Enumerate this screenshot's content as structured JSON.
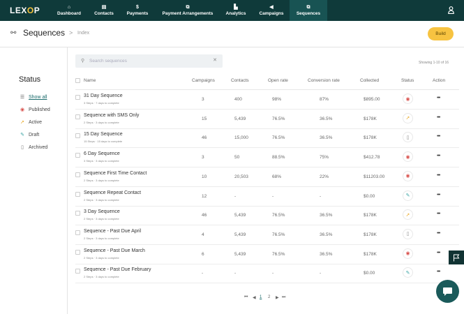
{
  "nav": {
    "logo": "LEXOP",
    "items": [
      {
        "icon": "⌂",
        "label": "Dashboard"
      },
      {
        "icon": "▤",
        "label": "Contacts"
      },
      {
        "icon": "$",
        "label": "Payments"
      },
      {
        "icon": "⧉",
        "label": "Payment Arrangements"
      },
      {
        "icon": "▙",
        "label": "Analytics"
      },
      {
        "icon": "◀",
        "label": "Campaigns"
      },
      {
        "icon": "⧉",
        "label": "Sequences"
      }
    ],
    "active": "Sequences"
  },
  "header": {
    "title": "Sequences",
    "separator": ">",
    "breadcrumb": "Index",
    "build_label": "Build"
  },
  "sidebar": {
    "title": "Status",
    "items": [
      {
        "label": "Show all",
        "icon": "list-icon"
      },
      {
        "label": "Published",
        "icon": "eye-icon"
      },
      {
        "label": "Active",
        "icon": "rocket-icon"
      },
      {
        "label": "Draft",
        "icon": "edit-icon"
      },
      {
        "label": "Archived",
        "icon": "archive-icon"
      }
    ]
  },
  "search": {
    "placeholder": "Search sequences",
    "value": ""
  },
  "showing": "Showing 1-10 of 16",
  "table": {
    "columns": [
      "Name",
      "Campaigns",
      "Contacts",
      "Open rate",
      "Conversion rate",
      "Collected",
      "Status",
      "Action"
    ],
    "rows": [
      {
        "name": "31 Day Sequence",
        "sub": "3 Steps  ·  7 days to complete",
        "campaigns": "3",
        "contacts": "400",
        "open": "98%",
        "conv": "87%",
        "collected": "$895.00",
        "status": "published"
      },
      {
        "name": "Sequence with SMS Only",
        "sub": "2 Steps  ·  3 days to complete",
        "campaigns": "15",
        "contacts": "5,439",
        "open": "76.5%",
        "conv": "36.5%",
        "collected": "$178K",
        "status": "active"
      },
      {
        "name": "15 Day Sequence",
        "sub": "15 Steps  ·  15 days to complete",
        "campaigns": "46",
        "contacts": "15,000",
        "open": "76.5%",
        "conv": "36.5%",
        "collected": "$178K",
        "status": "archived"
      },
      {
        "name": "6 Day Sequence",
        "sub": "3 Steps  ·  3 days to complete",
        "campaigns": "3",
        "contacts": "50",
        "open": "88.5%",
        "conv": "75%",
        "collected": "$412.78",
        "status": "published"
      },
      {
        "name": "Sequence First Time Contact",
        "sub": "2 Steps  ·  3 days to complete",
        "campaigns": "10",
        "contacts": "20,503",
        "open": "68%",
        "conv": "22%",
        "collected": "$11203.00",
        "status": "published"
      },
      {
        "name": "Sequence Repeat Contact",
        "sub": "2 Steps  ·  3 days to complete",
        "campaigns": "12",
        "contacts": "-",
        "open": "-",
        "conv": "-",
        "collected": "$0.00",
        "status": "draft"
      },
      {
        "name": "3 Day Sequence",
        "sub": "2 Steps  ·  3 days to complete",
        "campaigns": "46",
        "contacts": "5,439",
        "open": "76.5%",
        "conv": "36.5%",
        "collected": "$178K",
        "status": "active"
      },
      {
        "name": "Sequence - Past Due April",
        "sub": "2 Steps  ·  3 days to complete",
        "campaigns": "4",
        "contacts": "5,439",
        "open": "76.5%",
        "conv": "36.5%",
        "collected": "$178K",
        "status": "archived"
      },
      {
        "name": "Sequence - Past Due March",
        "sub": "2 Steps  ·  3 days to complete",
        "campaigns": "6",
        "contacts": "5,439",
        "open": "76.5%",
        "conv": "36.5%",
        "collected": "$178K",
        "status": "published"
      },
      {
        "name": "Sequence - Past Due February",
        "sub": "2 Steps  ·  3 days to complete",
        "campaigns": "-",
        "contacts": "-",
        "open": "-",
        "conv": "-",
        "collected": "$0.00",
        "status": "draft"
      }
    ],
    "action_label": "•••"
  },
  "pagination": {
    "first": "⏮",
    "prev": "◀",
    "pages": [
      "1",
      "2"
    ],
    "current": "1",
    "next": "▶",
    "last": "⏭"
  },
  "colors": {
    "nav_bg": "#0f3a3a",
    "nav_active": "#185353",
    "accent": "#f7c341",
    "published": "#d9534f",
    "active": "#e8a317",
    "draft": "#3aa3a3",
    "archived": "#888888"
  }
}
